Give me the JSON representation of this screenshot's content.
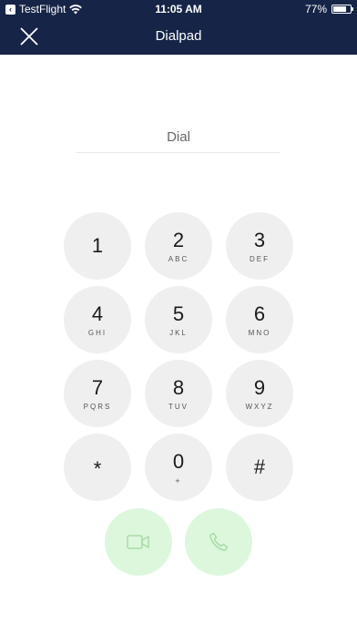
{
  "status_bar": {
    "back_app": "TestFlight",
    "time": "11:05 AM",
    "battery_text": "77%",
    "battery_level": 0.77
  },
  "nav": {
    "title": "Dialpad",
    "close_icon": "close-icon"
  },
  "dial_input": {
    "placeholder": "Dial",
    "value": ""
  },
  "keys": [
    {
      "digit": "1",
      "letters": ""
    },
    {
      "digit": "2",
      "letters": "ABC"
    },
    {
      "digit": "3",
      "letters": "DEF"
    },
    {
      "digit": "4",
      "letters": "GHI"
    },
    {
      "digit": "5",
      "letters": "JKL"
    },
    {
      "digit": "6",
      "letters": "MNO"
    },
    {
      "digit": "7",
      "letters": "PQRS"
    },
    {
      "digit": "8",
      "letters": "TUV"
    },
    {
      "digit": "9",
      "letters": "WXYZ"
    },
    {
      "digit": "*",
      "letters": ""
    },
    {
      "digit": "0",
      "letters": "+"
    },
    {
      "digit": "#",
      "letters": ""
    }
  ],
  "actions": {
    "video_call_icon": "video-camera-icon",
    "voice_call_icon": "phone-icon",
    "call_color": "#dcf7dc",
    "icon_color": "#a8dba8"
  },
  "colors": {
    "header": "#162447",
    "key_background": "#efefef"
  }
}
